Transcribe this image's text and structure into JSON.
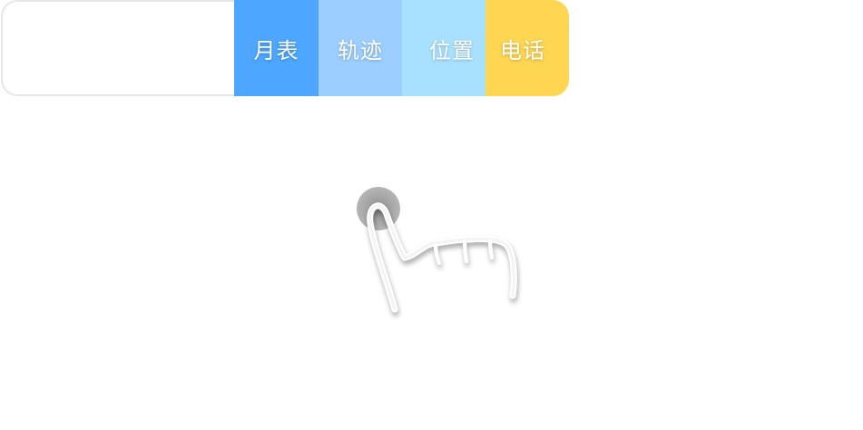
{
  "swipe_row": {
    "content_text": "",
    "actions": [
      {
        "label": "月表",
        "color": "#4da6ff"
      },
      {
        "label": "轨迹",
        "color": "#9ccfff"
      },
      {
        "label": "位置",
        "color": "#a8e1ff"
      },
      {
        "label": "电话",
        "color": "#ffd651"
      }
    ]
  },
  "gesture": {
    "icon": "swipe-left-hand-icon",
    "touch_color": "#9a9a9a"
  }
}
